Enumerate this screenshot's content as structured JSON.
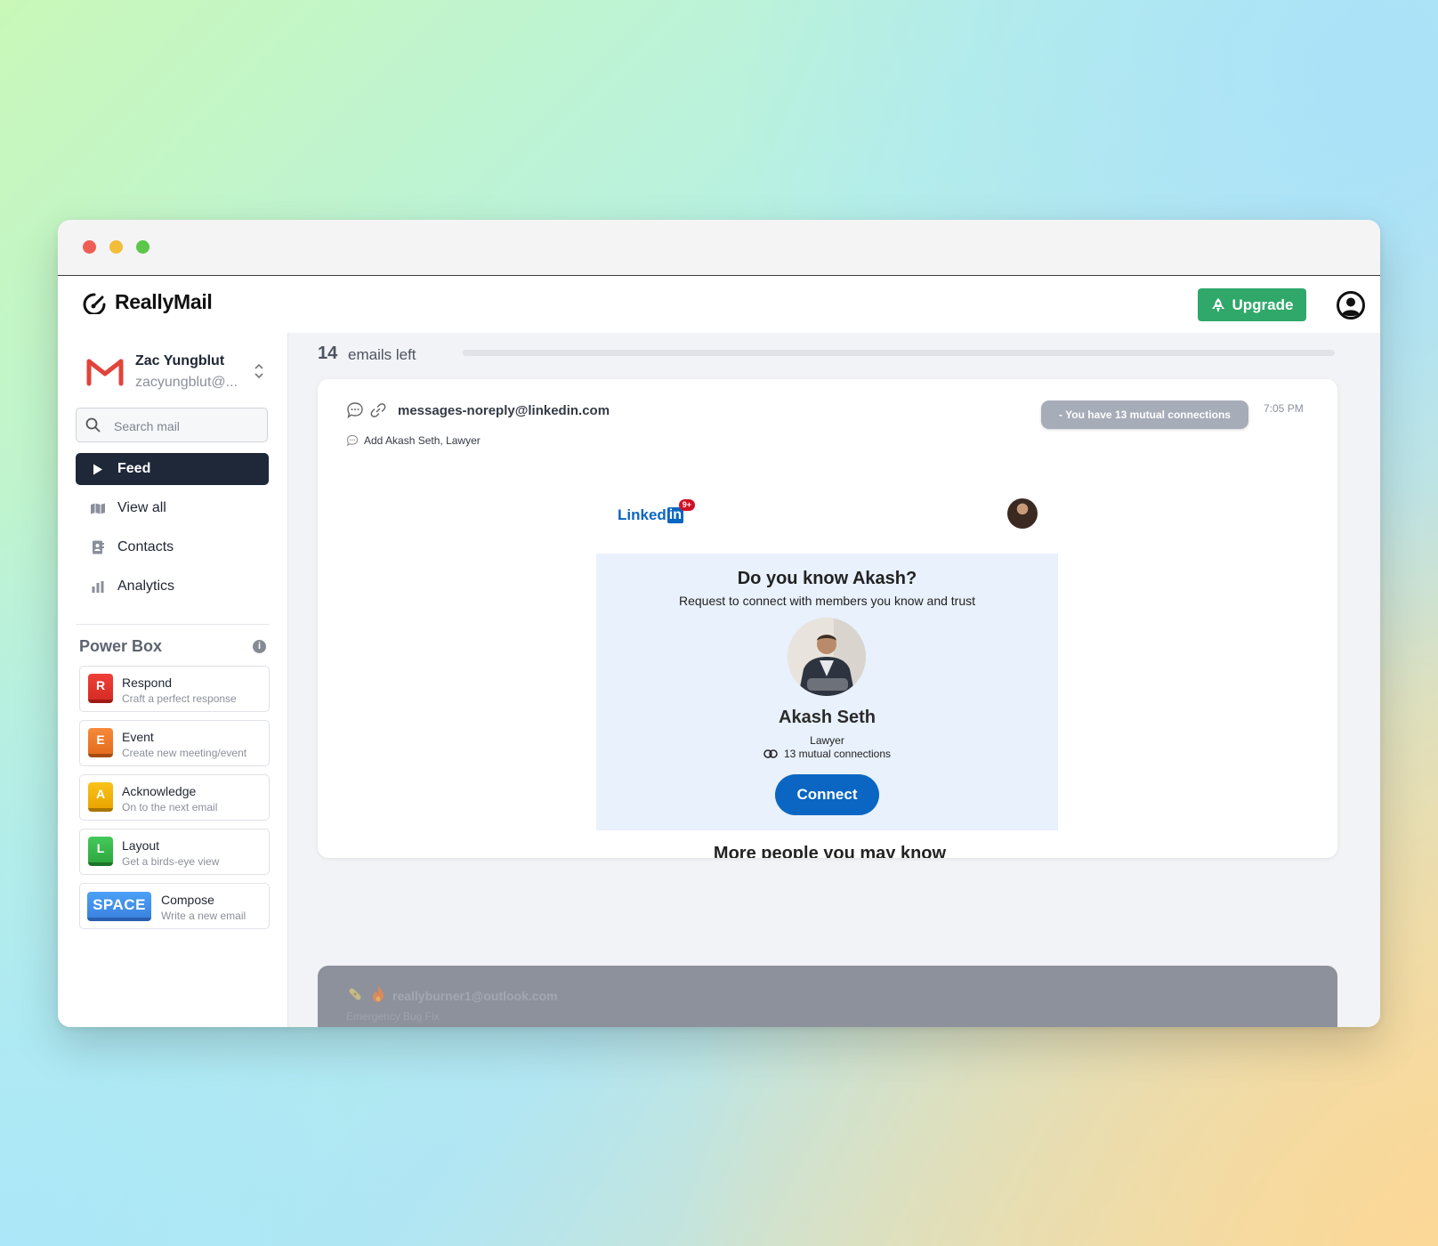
{
  "app": {
    "name": "ReallyMail",
    "upgrade_label": "Upgrade"
  },
  "account": {
    "name": "Zac Yungblut",
    "email": "zacyungblut@..."
  },
  "search": {
    "placeholder": "Search mail"
  },
  "nav": [
    {
      "label": "Feed",
      "icon": "play-icon",
      "active": true
    },
    {
      "label": "View all",
      "icon": "map-icon",
      "active": false
    },
    {
      "label": "Contacts",
      "icon": "address-book-icon",
      "active": false
    },
    {
      "label": "Analytics",
      "icon": "bar-chart-icon",
      "active": false
    }
  ],
  "power_box": {
    "title": "Power Box",
    "items": [
      {
        "key": "R",
        "label": "Respond",
        "sub": "Craft a perfect response",
        "color": "#e5322d"
      },
      {
        "key": "E",
        "label": "Event",
        "sub": "Create new meeting/event",
        "color": "#f07a2a"
      },
      {
        "key": "A",
        "label": "Acknowledge",
        "sub": "On to the next email",
        "color": "#f4b400"
      },
      {
        "key": "L",
        "label": "Layout",
        "sub": "Get a birds-eye view",
        "color": "#34b448"
      },
      {
        "key": "SPACE",
        "label": "Compose",
        "sub": "Write a new email",
        "color": "#3a84e0"
      }
    ],
    "arrow_keys": [
      "arrow-up-icon",
      "arrow-down-icon",
      "arrow-left-icon",
      "arrow-right-icon"
    ]
  },
  "feed": {
    "count": "14",
    "count_label": "emails left",
    "progress": 0.0
  },
  "email": {
    "sender": "messages-noreply@linkedin.com",
    "subject": "Add Akash Seth, Lawyer",
    "pill": "- You have 13 mutual connections",
    "time": "7:05 PM",
    "body": {
      "logo_text": "Linked",
      "logo_in": "in",
      "badge": "9+",
      "heading": "Do you know Akash?",
      "subheading": "Request to connect with members you know and trust",
      "person_name": "Akash Seth",
      "person_role": "Lawyer",
      "mutual": "13 mutual connections",
      "connect_label": "Connect",
      "more_heading": "More people you may know"
    }
  },
  "next_email": {
    "sender": "reallyburner1@outlook.com",
    "subject": "Emergency Bug Fix"
  },
  "colors": {
    "accent_green": "#2fa86a",
    "nav_active": "#1f2839",
    "linkedin_blue": "#0a66c2"
  }
}
